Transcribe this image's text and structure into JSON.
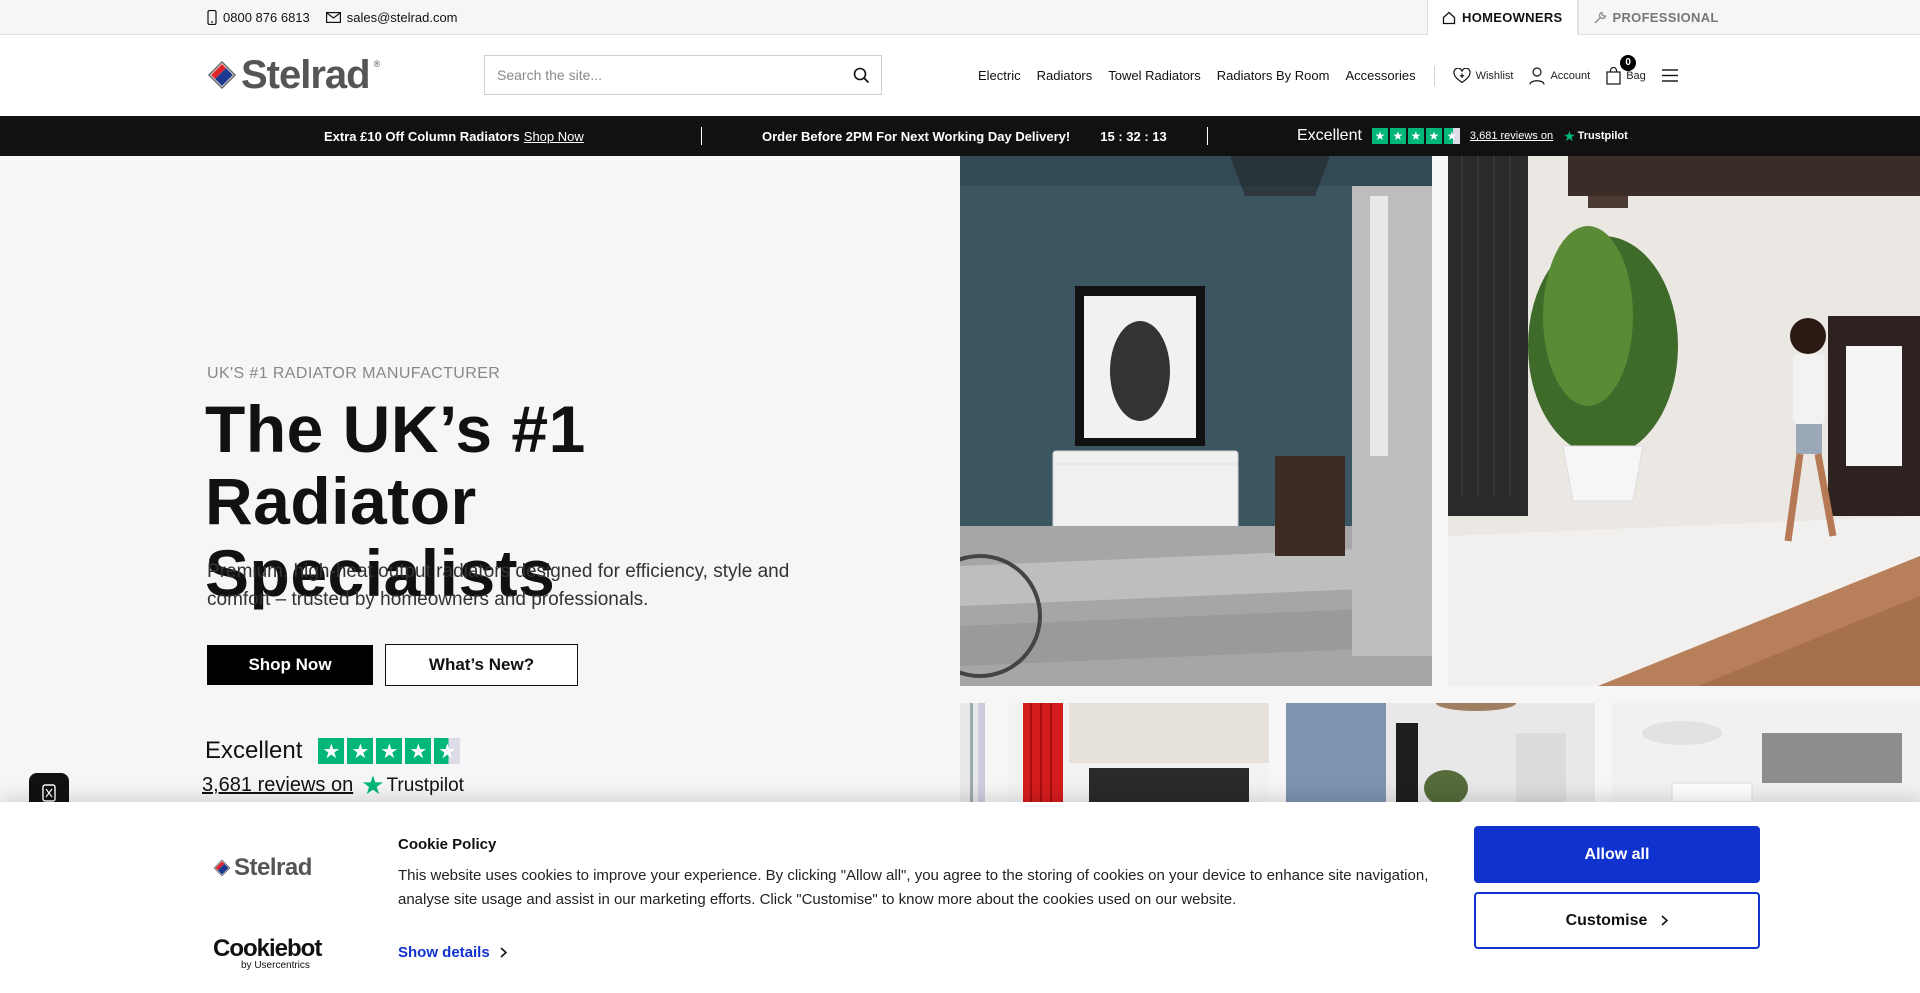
{
  "utility": {
    "phone": "0800 876 6813",
    "email": "sales@stelrad.com",
    "audience_tabs": [
      {
        "label": "HOMEOWNERS",
        "active": true
      },
      {
        "label": "PROFESSIONAL",
        "active": false
      }
    ]
  },
  "header": {
    "logo_text": "Stelrad",
    "logo_reg": "®",
    "search_placeholder": "Search the site...",
    "nav": [
      "Electric",
      "Radiators",
      "Towel Radiators",
      "Radiators By Room",
      "Accessories"
    ],
    "wishlist_label": "Wishlist",
    "account_label": "Account",
    "bag_label": "Bag",
    "bag_count": "0"
  },
  "promo": {
    "offer_text": "Extra £10 Off Column Radiators",
    "offer_link": "Shop Now",
    "delivery_text": "Order Before 2PM For Next Working Day Delivery!",
    "countdown": "15 : 32 : 13",
    "rating_word": "Excellent",
    "reviews_link": "3,681 reviews on",
    "trustpilot": "Trustpilot"
  },
  "hero": {
    "eyebrow": "UK'S #1 RADIATOR MANUFACTURER",
    "headline_line1": "The UK’s #1",
    "headline_line2": "Radiator Specialists",
    "subtext": "Premium, high-heat output radiators designed for efficiency, style and comfort – trusted by homeowners and professionals.",
    "primary_cta": "Shop Now",
    "secondary_cta": "What’s New?",
    "tp_rating_word": "Excellent",
    "tp_reviews": "3,681 reviews on",
    "tp_brand": "Trustpilot",
    "tp_stars": 4.5
  },
  "cookie": {
    "logo_text": "Stelrad",
    "title": "Cookie Policy",
    "body": "This website uses cookies to improve your experience. By clicking \"Allow all\", you agree to the storing of cookies on your device to enhance site navigation, analyse site usage and assist in our marketing efforts. Click \"Customise\" to know more about the cookies used on our website.",
    "show_details": "Show details",
    "allow_all": "Allow all",
    "customise": "Customise",
    "cookiebot_brand": "Cookiebot",
    "cookiebot_by": "by Usercentrics"
  },
  "colors": {
    "accent_blue": "#1032cf",
    "trustpilot_green": "#00b67a",
    "promo_bg": "#111111"
  }
}
